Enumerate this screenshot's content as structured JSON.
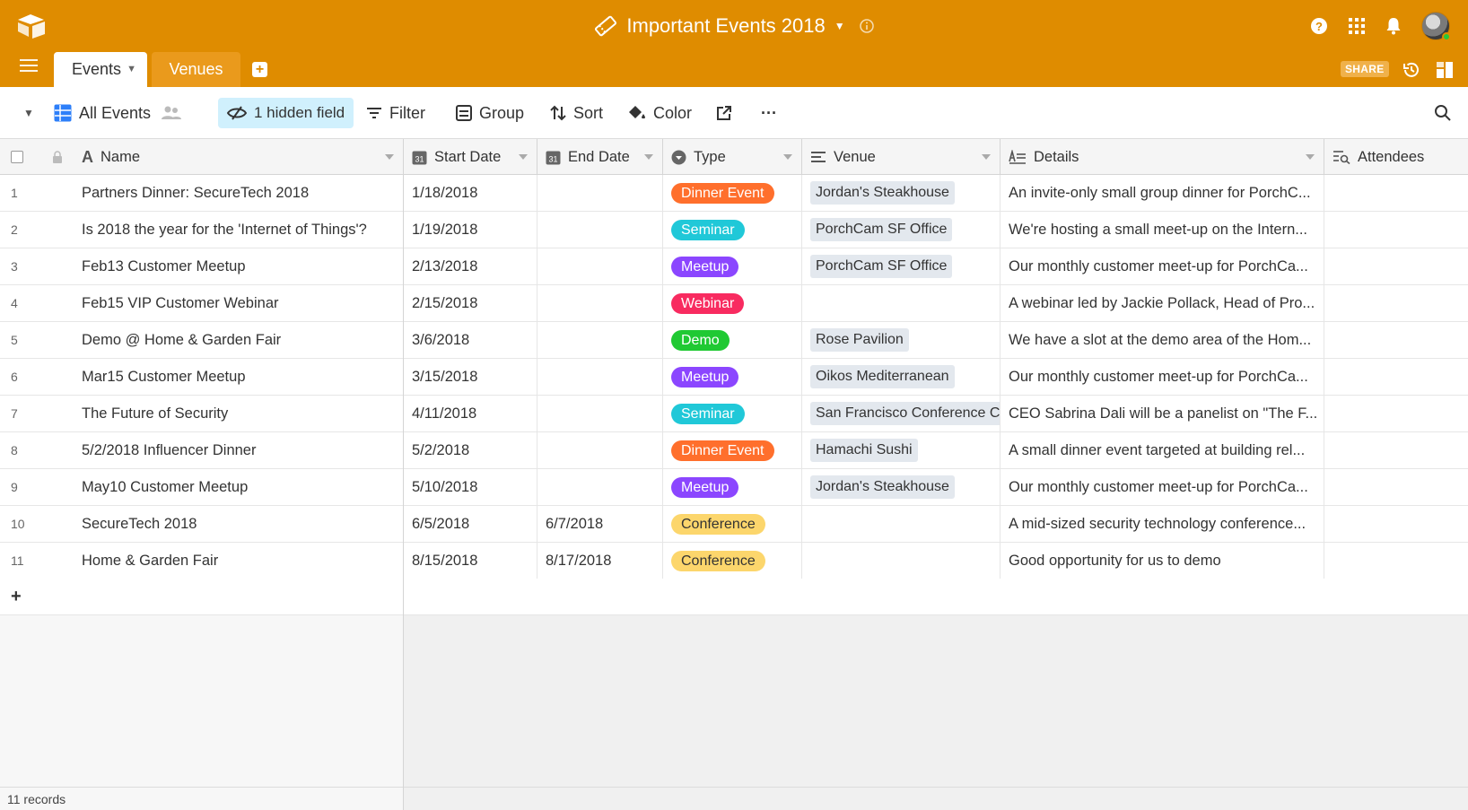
{
  "base": {
    "title": "Important Events 2018"
  },
  "tabs": {
    "events": "Events",
    "venues": "Venues"
  },
  "topbar": {
    "share_label": "SHARE"
  },
  "toolbar": {
    "view_name": "All Events",
    "hidden_fields": "1 hidden field",
    "filter": "Filter",
    "group": "Group",
    "sort": "Sort",
    "color": "Color",
    "more": "···"
  },
  "columns": {
    "name": "Name",
    "start_date": "Start Date",
    "end_date": "End Date",
    "type": "Type",
    "venue": "Venue",
    "details": "Details",
    "attendees": "Attendees"
  },
  "type_colors": {
    "Dinner Event": "#ff6f2c",
    "Seminar": "#20c8d8",
    "Meetup": "#8b46ff",
    "Webinar": "#f82b60",
    "Demo": "#20c933",
    "Conference": "#fcd66c"
  },
  "rows": [
    {
      "num": "1",
      "name": "Partners Dinner: SecureTech 2018",
      "start": "1/18/2018",
      "end": "",
      "type": "Dinner Event",
      "venue": "Jordan's Steakhouse",
      "details": "An invite-only small group dinner for PorchC..."
    },
    {
      "num": "2",
      "name": "Is 2018 the year for the 'Internet of Things'?",
      "start": "1/19/2018",
      "end": "",
      "type": "Seminar",
      "venue": "PorchCam SF Office",
      "details": "We're hosting a small meet-up on the Intern..."
    },
    {
      "num": "3",
      "name": "Feb13 Customer Meetup",
      "start": "2/13/2018",
      "end": "",
      "type": "Meetup",
      "venue": "PorchCam SF Office",
      "details": "Our monthly customer meet-up for PorchCa..."
    },
    {
      "num": "4",
      "name": "Feb15 VIP Customer Webinar",
      "start": "2/15/2018",
      "end": "",
      "type": "Webinar",
      "venue": "",
      "details": "A webinar led by Jackie Pollack, Head of Pro..."
    },
    {
      "num": "5",
      "name": "Demo @ Home & Garden Fair",
      "start": "3/6/2018",
      "end": "",
      "type": "Demo",
      "venue": "Rose Pavilion",
      "details": "We have a slot at the demo area of the Hom..."
    },
    {
      "num": "6",
      "name": "Mar15 Customer Meetup",
      "start": "3/15/2018",
      "end": "",
      "type": "Meetup",
      "venue": "Oikos Mediterranean",
      "details": "Our monthly customer meet-up for PorchCa..."
    },
    {
      "num": "7",
      "name": "The Future of Security",
      "start": "4/11/2018",
      "end": "",
      "type": "Seminar",
      "venue": "San Francisco Conference C",
      "details": "CEO Sabrina Dali will be a panelist on \"The F..."
    },
    {
      "num": "8",
      "name": "5/2/2018 Influencer Dinner",
      "start": "5/2/2018",
      "end": "",
      "type": "Dinner Event",
      "venue": "Hamachi Sushi",
      "details": "A small dinner event targeted at building rel..."
    },
    {
      "num": "9",
      "name": "May10 Customer Meetup",
      "start": "5/10/2018",
      "end": "",
      "type": "Meetup",
      "venue": "Jordan's Steakhouse",
      "details": "Our monthly customer meet-up for PorchCa..."
    },
    {
      "num": "10",
      "name": "SecureTech 2018",
      "start": "6/5/2018",
      "end": "6/7/2018",
      "type": "Conference",
      "venue": "",
      "details": "A mid-sized security technology conference..."
    },
    {
      "num": "11",
      "name": "Home & Garden Fair",
      "start": "8/15/2018",
      "end": "8/17/2018",
      "type": "Conference",
      "venue": "",
      "details": "Good opportunity for us to demo"
    }
  ],
  "footer": {
    "records": "11 records"
  }
}
